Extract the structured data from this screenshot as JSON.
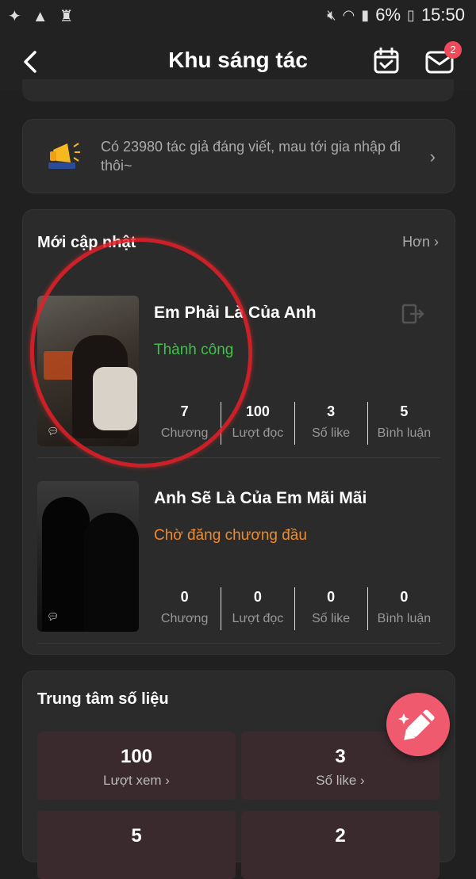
{
  "status_bar": {
    "battery": "6%",
    "time": "15:50"
  },
  "header": {
    "title": "Khu sáng tác",
    "mail_badge": "2"
  },
  "banner": {
    "text": "Có 23980 tác giả đáng viết, mau tới gia nhập đi thôi~"
  },
  "updates": {
    "title": "Mới cập nhật",
    "more_label": "Hơn",
    "stat_labels": [
      "Chương",
      "Lượt đọc",
      "Số like",
      "Bình luận"
    ],
    "items": [
      {
        "title": "Em Phải Là Của Anh",
        "status": "Thành công",
        "status_color": "#3cc44a",
        "stats": [
          "7",
          "100",
          "3",
          "5"
        ]
      },
      {
        "title": "Anh Sẽ Là Của Em Mãi Mãi",
        "status": "Chờ đăng chương đầu",
        "status_color": "#f08a2a",
        "stats": [
          "0",
          "0",
          "0",
          "0"
        ]
      }
    ]
  },
  "data_center": {
    "title": "Trung tâm số liệu",
    "tiles": [
      {
        "value": "100",
        "label": "Lượt xem"
      },
      {
        "value": "3",
        "label": "Số like"
      },
      {
        "value": "5",
        "label": ""
      },
      {
        "value": "2",
        "label": ""
      }
    ]
  }
}
